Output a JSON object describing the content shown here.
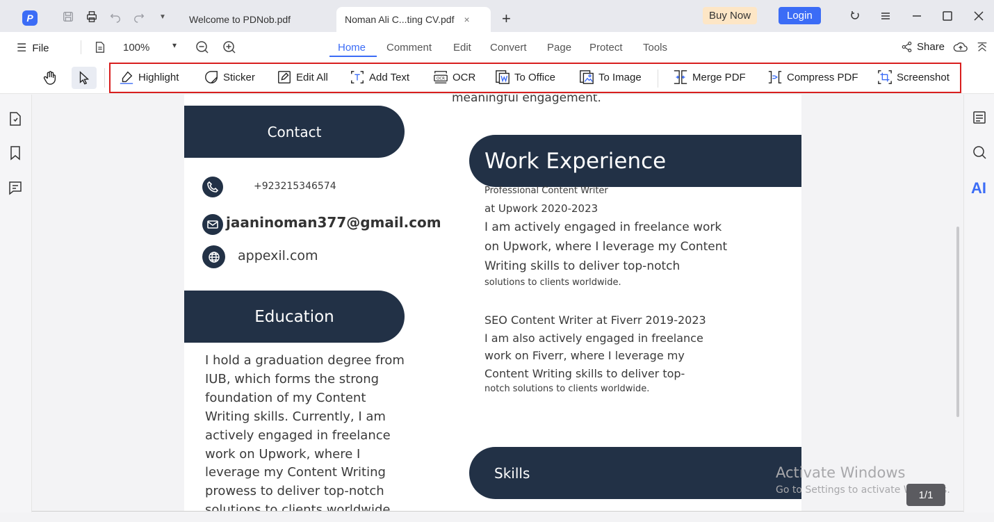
{
  "titlebar": {
    "tabs": [
      {
        "label": "Welcome to PDNob.pdf"
      },
      {
        "label": "Noman Ali C...ting CV.pdf"
      }
    ],
    "tab_close_glyph": "×",
    "new_tab_glyph": "+",
    "buy_label": "Buy Now",
    "login_label": "Login",
    "colors": {
      "accent": "#3b6cf6",
      "buy_bg": "#fde6c6"
    }
  },
  "menubar": {
    "file_label": "File",
    "zoom_value": "100%",
    "items": [
      "Home",
      "Comment",
      "Edit",
      "Convert",
      "Page",
      "Protect",
      "Tools"
    ],
    "active_item": "Home",
    "share_label": "Share"
  },
  "toolbar": {
    "tools": [
      {
        "label": "Highlight",
        "icon": "highlight-icon"
      },
      {
        "label": "Sticker",
        "icon": "sticker-icon"
      },
      {
        "label": "Edit All",
        "icon": "edit-all-icon"
      },
      {
        "label": "Add Text",
        "icon": "add-text-icon"
      },
      {
        "label": "OCR",
        "icon": "ocr-icon"
      },
      {
        "label": "To Office",
        "icon": "to-office-icon"
      },
      {
        "label": "To Image",
        "icon": "to-image-icon"
      },
      {
        "label": "Merge PDF",
        "icon": "merge-pdf-icon"
      },
      {
        "label": "Compress PDF",
        "icon": "compress-pdf-icon"
      },
      {
        "label": "Screenshot",
        "icon": "screenshot-icon"
      }
    ],
    "highlight_box_color": "#d81e1e"
  },
  "right_panel": {
    "ai_label": "AI"
  },
  "document": {
    "top_line": "meaningful engagement.",
    "contact_heading": "Contact",
    "phone": "+923215346574",
    "email": "jaaninoman377@gmail.com",
    "website": "appexil.com",
    "education_heading": "Education",
    "education_lines": [
      "I hold a graduation degree from",
      "IUB, which forms the strong",
      "foundation of my Content",
      "Writing skills. Currently, I am",
      "actively engaged in freelance",
      "work on Upwork, where I",
      "leverage my Content Writing",
      "prowess to deliver top-notch",
      "solutions to clients worldwide."
    ],
    "work_heading": "Work Experience",
    "job1_title": "Professional Content Writer",
    "job1_period": "at Upwork 2020-2023",
    "job1_lines": [
      "I am actively engaged in freelance work",
      "on Upwork, where I leverage my Content",
      "Writing skills to deliver top-notch"
    ],
    "job1_last": "solutions to clients worldwide.",
    "job2_title": "SEO Content Writer at Fiverr 2019-2023",
    "job2_lines": [
      "I am also actively engaged in freelance",
      "work on Fiverr, where I leverage my",
      "Content Writing skills to deliver top-"
    ],
    "job2_last": "notch solutions to clients worldwide.",
    "skills_heading": "Skills",
    "pill_color": "#223146"
  },
  "watermark": {
    "line1": "Activate Windows",
    "line2": "Go to Settings to activate Windows."
  },
  "page_indicator": "1/1"
}
